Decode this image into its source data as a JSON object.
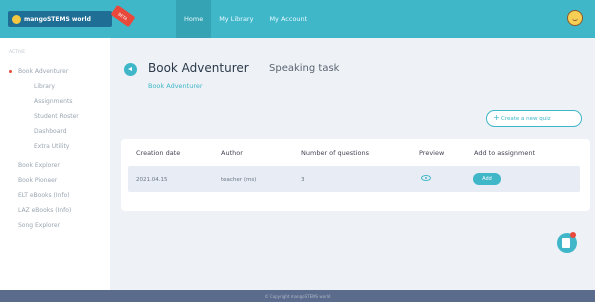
{
  "logo": {
    "text": "mangoSTEMS world",
    "ribbon": "BETA"
  },
  "nav": {
    "items": [
      "Home",
      "My Library",
      "My Account"
    ]
  },
  "sidebar": {
    "section": "ACTIVE",
    "items": [
      {
        "label": "Book Adventurer",
        "level": "main"
      },
      {
        "label": "Library",
        "level": "sub"
      },
      {
        "label": "Assignments",
        "level": "sub"
      },
      {
        "label": "Student Roster",
        "level": "sub"
      },
      {
        "label": "Dashboard",
        "level": "sub"
      },
      {
        "label": "Extra Utility",
        "level": "sub"
      },
      {
        "label": "Book Explorer",
        "level": "top"
      },
      {
        "label": "Book Pioneer",
        "level": "top"
      },
      {
        "label": "ELT eBooks (Info)",
        "level": "top"
      },
      {
        "label": "LAZ eBooks (Info)",
        "level": "top"
      },
      {
        "label": "Song Explorer",
        "level": "top"
      }
    ]
  },
  "page": {
    "title": "Book Adventurer",
    "subtitle": "Speaking task",
    "breadcrumb": "Book Adventurer"
  },
  "create_button": {
    "label": "Create a new quiz",
    "icon": "plus-icon"
  },
  "table": {
    "headers": [
      "Creation date",
      "Author",
      "Number of questions",
      "Preview",
      "Add to assignment"
    ],
    "rows": [
      {
        "date": "2021.04.15",
        "author": "teacher (ms)",
        "count": "3",
        "add_label": "Add"
      }
    ]
  },
  "footer": {
    "text": "© Copyright mangoSTEMS world"
  },
  "colors": {
    "accent": "#3fb7c9",
    "footer": "#5b6b8c",
    "danger": "#e8493b"
  }
}
